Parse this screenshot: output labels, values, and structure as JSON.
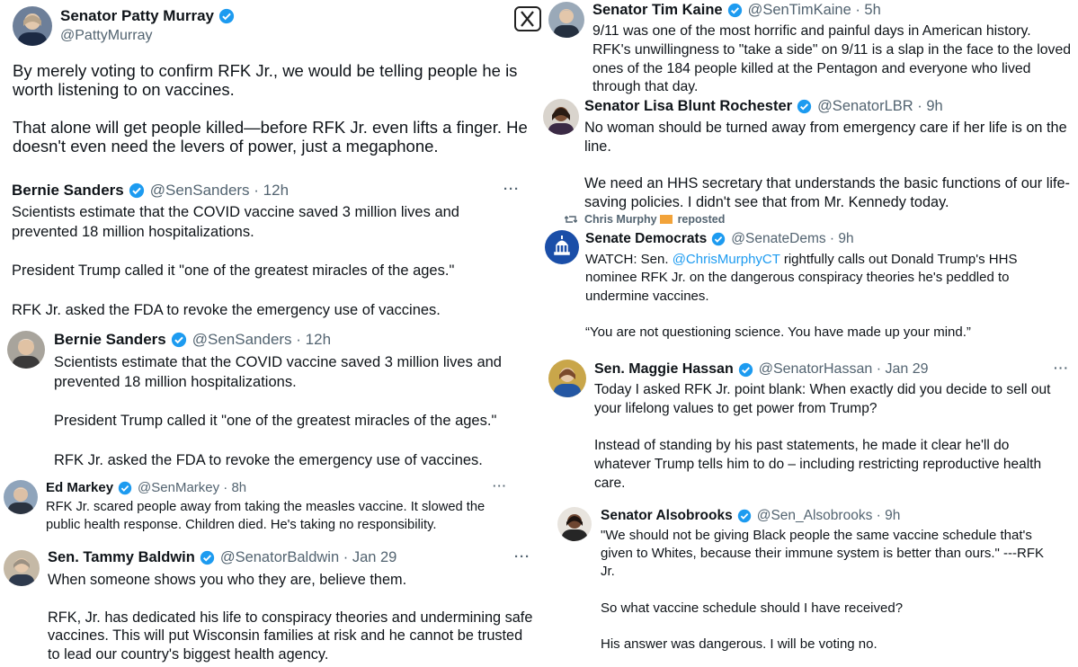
{
  "murray": {
    "name": "Senator Patty Murray",
    "handle": "@PattyMurray",
    "body": "By merely voting to confirm RFK Jr., we would be telling people he is\nworth listening to on vaccines.\n\nThat alone will get people killed—before RFK Jr. even lifts a finger. He\ndoesn't even need the levers of power, just a megaphone."
  },
  "sanders1": {
    "name": "Bernie Sanders",
    "handle": "@SenSanders · 12h",
    "body": "Scientists estimate that the COVID vaccine saved 3 million lives and\nprevented 18 million hospitalizations.\n\nPresident Trump called it \"one of the greatest miracles of the ages.\"\n\nRFK Jr. asked the FDA to revoke the emergency use of vaccines."
  },
  "sanders2": {
    "name": "Bernie Sanders",
    "handle": "@SenSanders · 12h",
    "body": "Scientists estimate that the COVID vaccine saved 3 million lives and\nprevented 18 million hospitalizations.\n\nPresident Trump called it \"one of the greatest miracles of the ages.\"\n\nRFK Jr. asked the FDA to revoke the emergency use of vaccines."
  },
  "markey": {
    "name": "Ed Markey",
    "handle": "@SenMarkey · 8h",
    "body": "RFK Jr. scared people away from taking the measles vaccine. It slowed the\npublic health response. Children died. He's taking no responsibility."
  },
  "baldwin": {
    "name": "Sen. Tammy Baldwin",
    "handle": "@SenatorBaldwin · Jan 29",
    "body": "When someone shows you who they are, believe them.\n\nRFK, Jr. has dedicated his life to conspiracy theories and undermining safe\nvaccines. This will put Wisconsin families at risk and he cannot be trusted\nto lead our country's biggest health agency."
  },
  "kaine": {
    "name": "Senator Tim Kaine",
    "handle": "@SenTimKaine · 5h",
    "body": "9/11 was one of the most horrific and painful days in American history.\nRFK's unwillingness to \"take a side\" on 9/11 is a slap in the face to the loved\nones of the 184 people killed at the Pentagon and everyone who lived\nthrough that day."
  },
  "rochester": {
    "name": "Senator Lisa Blunt Rochester",
    "handle": "@SenatorLBR · 9h",
    "body": "No woman should be turned away from emergency care if her life is on the\nline.\n\nWe need an HHS secretary that understands the basic functions of our life-\nsaving policies. I didn't see that from Mr. Kennedy today."
  },
  "dems": {
    "repost_label": "Chris Murphy",
    "repost_suffix": "reposted",
    "name": "Senate Democrats",
    "handle": "@SenateDems · 9h",
    "body_pre": "WATCH: Sen. ",
    "body_mention": "@ChrisMurphyCT",
    "body_post": " rightfully calls out Donald Trump's HHS\nnominee RFK Jr. on the dangerous conspiracy theories he's peddled to\nundermine vaccines.\n\n“You are not questioning science. You have made up your mind.”"
  },
  "hassan": {
    "name": "Sen. Maggie Hassan",
    "handle": "@SenatorHassan · Jan 29",
    "body": "Today I asked RFK Jr. point blank: When exactly did you decide to sell out\nyour lifelong values to get power from Trump?\n\nInstead of standing by his past statements, he made it clear he'll do\nwhatever Trump tells him to do – including restricting reproductive health\ncare."
  },
  "alsobrooks": {
    "name": "Senator Alsobrooks",
    "handle": "@Sen_Alsobrooks · 9h",
    "body": "\"We should not be giving Black people the same vaccine schedule that's\ngiven to Whites, because their immune system is better than ours.\" ---RFK\nJr.\n\nSo what vaccine schedule should I have received?\n\nHis answer was dangerous. I will be voting no."
  },
  "more_label": "···",
  "colors": {
    "verified": "#1d9bf0",
    "link": "#1d9bf0",
    "secondary": "#536471",
    "text": "#0f1419"
  }
}
